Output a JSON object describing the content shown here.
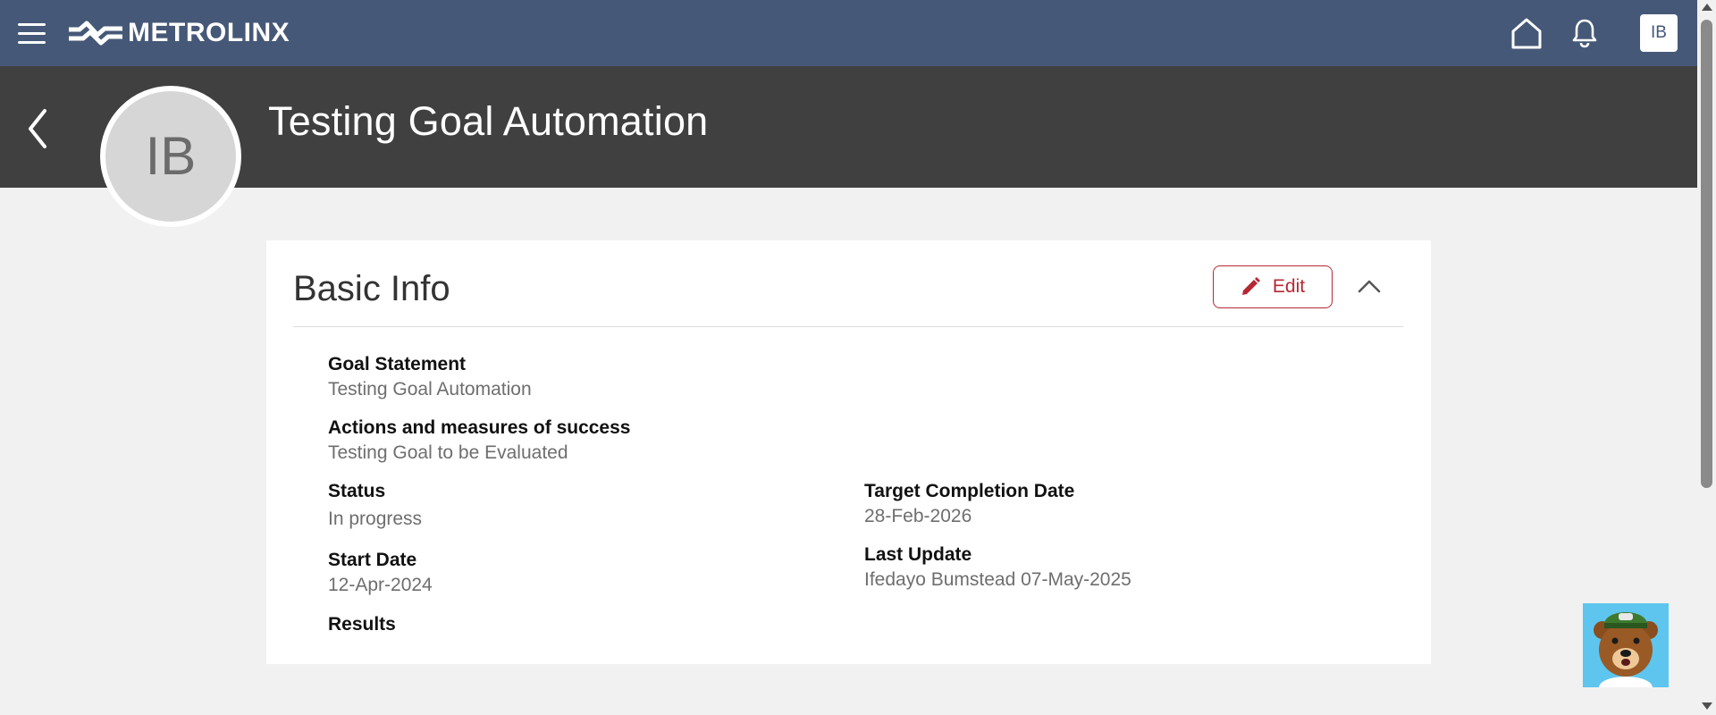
{
  "brand": {
    "name": "METROLINX",
    "colors": {
      "nav": "#465877",
      "header": "#404040",
      "accent": "#b52834",
      "page_bg": "#f1f1f1"
    }
  },
  "topbar": {
    "menu_icon": "hamburger-menu-icon",
    "home_icon": "home-icon",
    "notifications_icon": "bell-icon",
    "user_initials": "IB"
  },
  "header": {
    "back_icon": "chevron-left-icon",
    "title": "Testing Goal Automation",
    "avatar_initials": "IB"
  },
  "basic_info": {
    "title": "Basic Info",
    "edit_label": "Edit",
    "edit_icon": "pencil-icon",
    "collapse_icon": "chevron-up-icon",
    "fields": {
      "goal_statement": {
        "label": "Goal Statement",
        "value": "Testing Goal Automation"
      },
      "actions": {
        "label": "Actions and measures of success",
        "value": "Testing Goal to be Evaluated"
      },
      "status": {
        "label": "Status",
        "value": "In progress"
      },
      "target_completion": {
        "label": "Target Completion Date",
        "value": "28-Feb-2026"
      },
      "start_date": {
        "label": "Start Date",
        "value": "12-Apr-2024"
      },
      "last_update": {
        "label": "Last Update",
        "value": "Ifedayo Bumstead 07-May-2025"
      },
      "results": {
        "label": "Results",
        "value": ""
      }
    }
  },
  "assistant": {
    "icon": "bear-mascot-icon"
  }
}
